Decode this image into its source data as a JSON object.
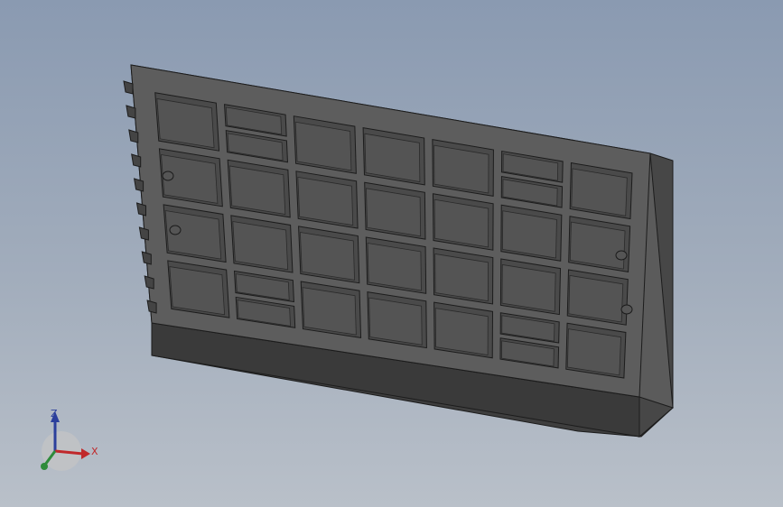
{
  "scene": {
    "model": "tray-plate",
    "body_color_top": "#5b5b5b",
    "body_color_front": "#3e3e3e",
    "body_color_side": "#474747",
    "pocket_color": "#4a4a4a",
    "edge_color": "#1c1c1c",
    "background_top": "#8a9ab1",
    "background_bottom": "#b9c0c9"
  },
  "triad": {
    "x_label": "X",
    "y_label": "",
    "z_label": "Z",
    "x_color": "#c0282a",
    "y_color": "#2e8b3a",
    "z_color": "#2b3f9c"
  }
}
